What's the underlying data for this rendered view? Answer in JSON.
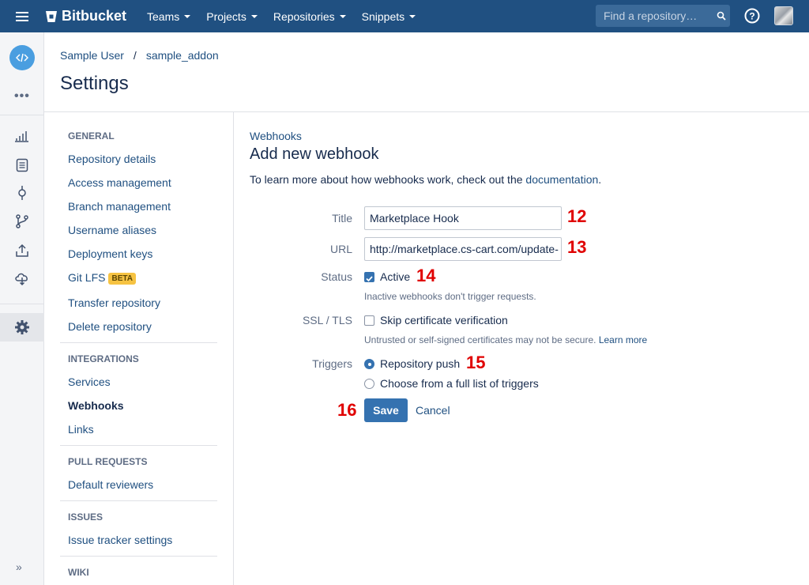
{
  "topbar": {
    "brand": "Bitbucket",
    "nav": [
      "Teams",
      "Projects",
      "Repositories",
      "Snippets"
    ],
    "search_placeholder": "Find a repository…"
  },
  "breadcrumb": {
    "owner": "Sample User",
    "separator": "/",
    "repo": "sample_addon"
  },
  "page_title": "Settings",
  "sidebar": {
    "groups": [
      {
        "heading": "GENERAL",
        "items": [
          "Repository details",
          "Access management",
          "Branch management",
          "Username aliases",
          "Deployment keys",
          "Git LFS",
          "Transfer repository",
          "Delete repository"
        ]
      },
      {
        "heading": "INTEGRATIONS",
        "items": [
          "Services",
          "Webhooks",
          "Links"
        ]
      },
      {
        "heading": "PULL REQUESTS",
        "items": [
          "Default reviewers"
        ]
      },
      {
        "heading": "ISSUES",
        "items": [
          "Issue tracker settings"
        ]
      },
      {
        "heading": "WIKI",
        "items": []
      }
    ],
    "beta_badge": "BETA",
    "current": "Webhooks"
  },
  "form": {
    "crumb": "Webhooks",
    "heading": "Add new webhook",
    "intro_prefix": "To learn more about how webhooks work, check out the ",
    "intro_link": "documentation",
    "intro_suffix": ".",
    "title_label": "Title",
    "title_value": "Marketplace Hook",
    "url_label": "URL",
    "url_value": "http://marketplace.cs-cart.com/update-",
    "status_label": "Status",
    "active_label": "Active",
    "active_checked": true,
    "active_hint": "Inactive webhooks don't trigger requests.",
    "ssl_label": "SSL / TLS",
    "skip_cert_label": "Skip certificate verification",
    "skip_cert_checked": false,
    "ssl_hint": "Untrusted or self-signed certificates may not be secure.",
    "ssl_hint_link": "Learn more",
    "triggers_label": "Triggers",
    "trigger_options": [
      "Repository push",
      "Choose from a full list of triggers"
    ],
    "trigger_selected": "Repository push",
    "save_label": "Save",
    "cancel_label": "Cancel"
  },
  "annotations": [
    "12",
    "13",
    "14",
    "15",
    "16"
  ],
  "colors": {
    "topbar": "#205081",
    "link": "#205081",
    "primary_button": "#3572b0",
    "annotation": "#e00000",
    "beta_badge": "#f6c342"
  }
}
